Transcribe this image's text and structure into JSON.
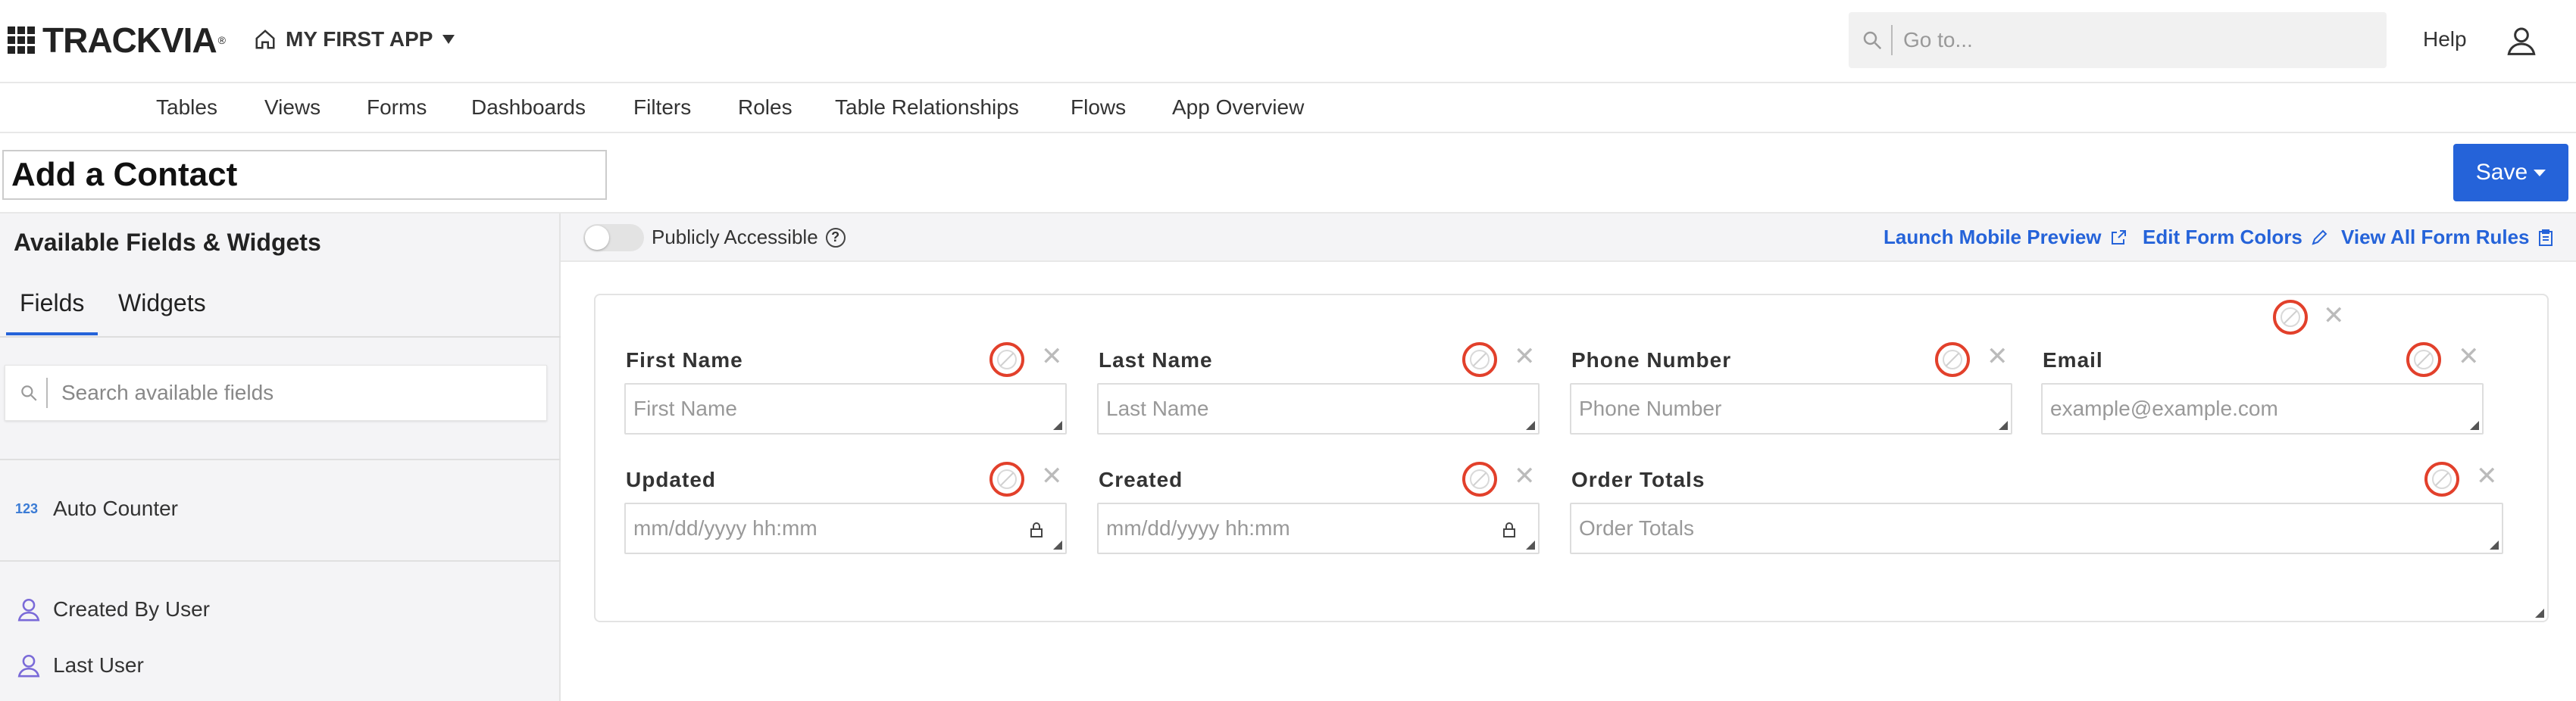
{
  "brand": {
    "logo": "TRACKVIA",
    "registered": "®"
  },
  "app": {
    "name": "MY FIRST APP"
  },
  "search": {
    "placeholder": "Go to..."
  },
  "header": {
    "help": "Help"
  },
  "nav": [
    "Tables",
    "Views",
    "Forms",
    "Dashboards",
    "Filters",
    "Roles",
    "Table Relationships",
    "Flows",
    "App Overview"
  ],
  "form": {
    "title": "Add a Contact",
    "save": "Save"
  },
  "sidebar": {
    "heading": "Available Fields & Widgets",
    "tabs": [
      "Fields",
      "Widgets"
    ],
    "search_placeholder": "Search available fields",
    "items": [
      {
        "icon": "123",
        "label": "Auto Counter"
      },
      {
        "icon": "user-icon",
        "label": "Created By User"
      },
      {
        "icon": "user-icon",
        "label": "Last User"
      }
    ]
  },
  "toolbar": {
    "public": "Publicly Accessible",
    "launch": "Launch Mobile Preview",
    "colors": "Edit Form Colors",
    "rules": "View All Form Rules"
  },
  "fields": [
    {
      "label": "First Name",
      "placeholder": "First Name"
    },
    {
      "label": "Last Name",
      "placeholder": "Last Name"
    },
    {
      "label": "Phone Number",
      "placeholder": "Phone Number"
    },
    {
      "label": "Email",
      "placeholder": "example@example.com"
    },
    {
      "label": "Updated",
      "placeholder": "mm/dd/yyyy hh:mm"
    },
    {
      "label": "Created",
      "placeholder": "mm/dd/yyyy hh:mm"
    },
    {
      "label": "Order Totals",
      "placeholder": "Order Totals"
    }
  ],
  "colors": {
    "accent": "#2563d9",
    "rule_ring": "#e2402b"
  }
}
